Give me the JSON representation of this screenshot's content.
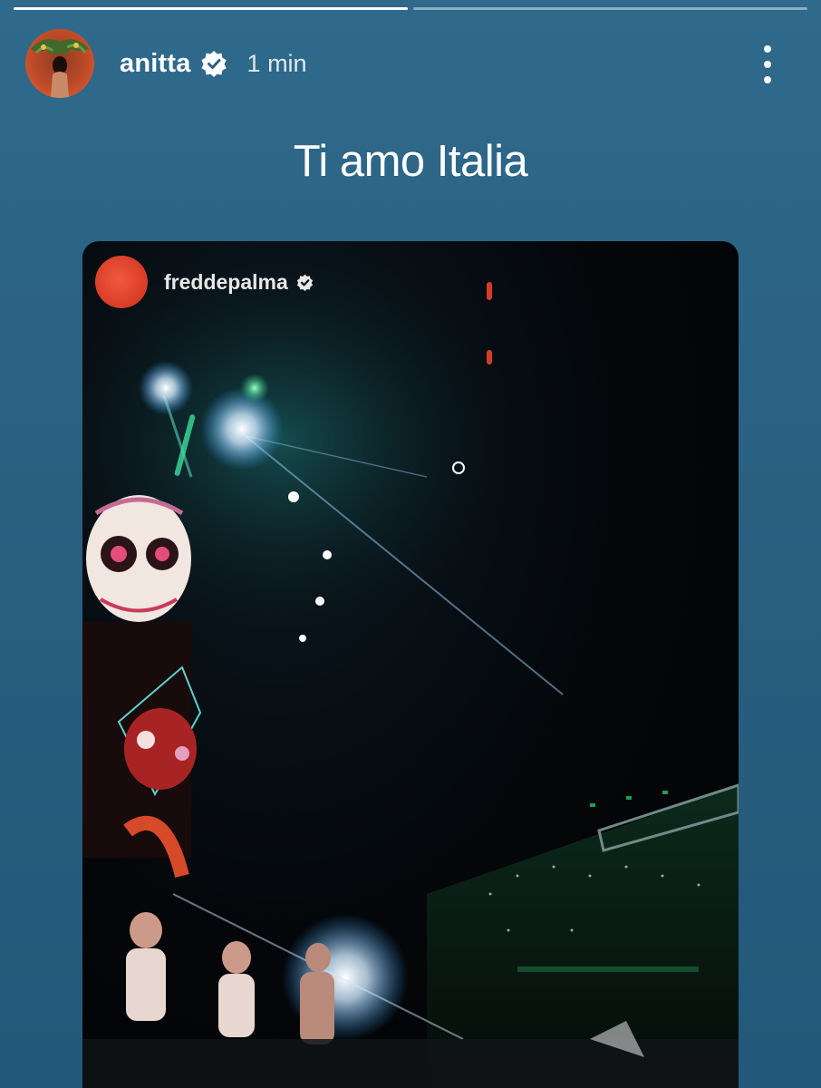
{
  "story": {
    "progress": [
      {
        "fill_percent": 100
      },
      {
        "fill_percent": 0
      }
    ],
    "header": {
      "username": "anitta",
      "verified": true,
      "time": "1 min",
      "more_icon": "more-vertical-icon"
    },
    "caption": "Ti amo Italia",
    "shared_post": {
      "username": "freddepalma",
      "verified": true,
      "media_description_icon": "concert-video"
    }
  },
  "colors": {
    "background_top": "#2f6a8c",
    "background_bottom": "#24587a",
    "text": "#ffffff"
  }
}
